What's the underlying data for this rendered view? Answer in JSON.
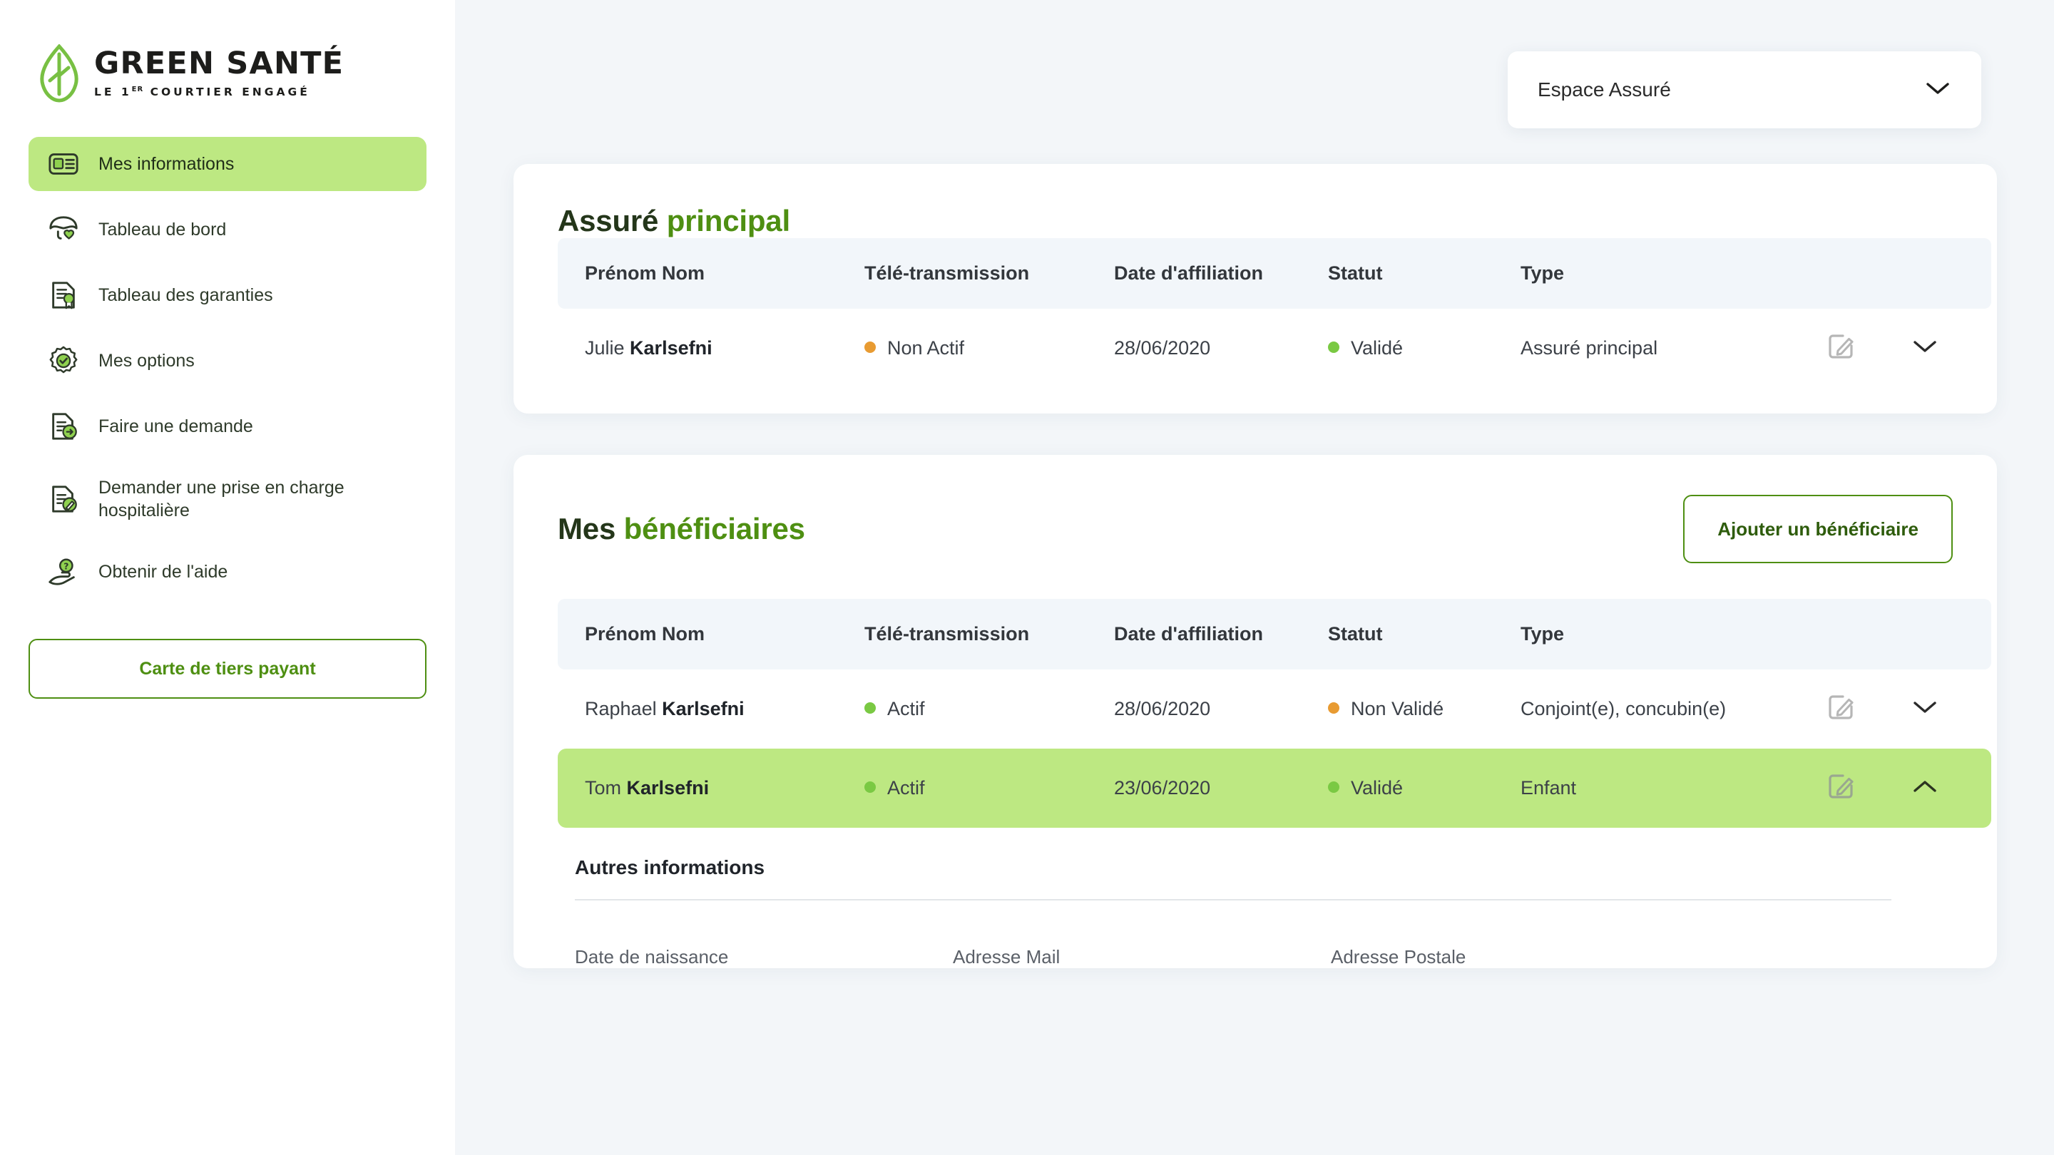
{
  "brand": {
    "name": "GREEN SANTÉ",
    "tagline_pre": "LE 1",
    "tagline_sup": "ER",
    "tagline_post": " COURTIER ENGAGÉ",
    "leaf_color": "#78c043",
    "wordmark_color": "#1d1d1b"
  },
  "colors": {
    "accent_green": "#4e8f12",
    "highlight_green": "#bde882",
    "status_green": "#7ac943",
    "status_orange": "#e89b32",
    "page_bg": "#f3f6f9",
    "table_head_bg": "#f2f6fa"
  },
  "sidebar": {
    "items": [
      {
        "label": "Mes informations",
        "icon": "id-card-icon",
        "active": true
      },
      {
        "label": "Tableau de bord",
        "icon": "umbrella-heart-icon",
        "active": false
      },
      {
        "label": "Tableau des garanties",
        "icon": "document-award-icon",
        "active": false
      },
      {
        "label": "Mes options",
        "icon": "badge-check-icon",
        "active": false
      },
      {
        "label": "Faire une demande",
        "icon": "document-arrow-icon",
        "active": false
      },
      {
        "label": "Demander une prise en charge hospitalière",
        "icon": "document-pencil-icon",
        "active": false
      },
      {
        "label": "Obtenir de l'aide",
        "icon": "hand-question-icon",
        "active": false
      }
    ],
    "card_button": "Carte de tiers payant"
  },
  "topbar": {
    "space_selector": {
      "value": "Espace Assuré",
      "icon": "chevron-down-icon"
    }
  },
  "principal": {
    "title_lead": "Assuré",
    "title_accent": "principal",
    "columns": [
      "Prénom Nom",
      "Télé-transmission",
      "Date d'affiliation",
      "Statut",
      "Type"
    ],
    "rows": [
      {
        "first_name": "Julie",
        "last_name": "Karlsefni",
        "teletransmission": "Non Actif",
        "teletransmission_state": "orange",
        "date": "28/06/2020",
        "statut": "Validé",
        "statut_state": "green",
        "type": "Assuré principal",
        "edit_icon": "edit-square-icon",
        "expand_icon": "chevron-down-icon",
        "expanded": false,
        "highlighted": false
      }
    ]
  },
  "beneficiaries": {
    "title_lead": "Mes",
    "title_accent": "bénéficiaires",
    "add_button": "Ajouter un bénéficiaire",
    "columns": [
      "Prénom Nom",
      "Télé-transmission",
      "Date d'affiliation",
      "Statut",
      "Type"
    ],
    "rows": [
      {
        "first_name": "Raphael",
        "last_name": "Karlsefni",
        "teletransmission": "Actif",
        "teletransmission_state": "green",
        "date": "28/06/2020",
        "statut": "Non Validé",
        "statut_state": "orange",
        "type": "Conjoint(e), concubin(e)",
        "edit_icon": "edit-square-icon",
        "expand_icon": "chevron-down-icon",
        "expanded": false,
        "highlighted": false
      },
      {
        "first_name": "Tom",
        "last_name": "Karlsefni",
        "teletransmission": "Actif",
        "teletransmission_state": "green",
        "date": "23/06/2020",
        "statut": "Validé",
        "statut_state": "green",
        "type": "Enfant",
        "edit_icon": "edit-square-icon",
        "expand_icon": "chevron-up-icon",
        "expanded": true,
        "highlighted": true
      }
    ],
    "details": {
      "title": "Autres informations",
      "fields": [
        "Date de naissance",
        "Adresse Mail",
        "Adresse Postale"
      ]
    }
  }
}
